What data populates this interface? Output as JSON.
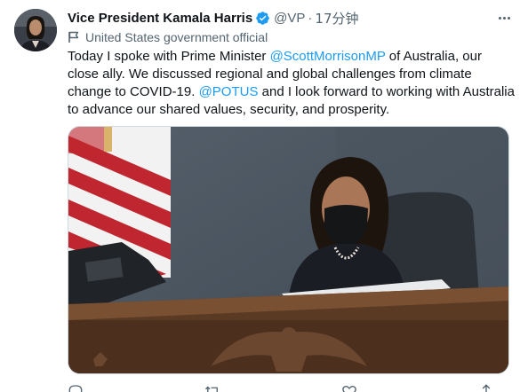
{
  "author": {
    "name": "Vice President Kamala Harris",
    "handle": "@VP",
    "separator": "·",
    "time": "17分钟",
    "label": "United States government official",
    "verified": true,
    "avatar_icon": "profile-photo"
  },
  "tweet": {
    "text_1": "Today I spoke with Prime Minister ",
    "mention_1": "@ScottMorrisonMP",
    "text_2": " of Australia, our close ally. We discussed regional and global challenges from climate change to COVID-19. ",
    "mention_2": "@POTUS",
    "text_3": " and I look forward to working with Australia to advance our shared values, security, and prosperity."
  },
  "media": {
    "icon": "photo",
    "description_hidden": true
  },
  "actions": [
    {
      "icon": "reply-icon"
    },
    {
      "icon": "retweet-icon"
    },
    {
      "icon": "like-icon"
    },
    {
      "icon": "share-icon"
    }
  ],
  "colors": {
    "accent": "#1d9bf0",
    "text": "#0f1419",
    "secondary": "#536471",
    "border": "#cfd9de"
  }
}
